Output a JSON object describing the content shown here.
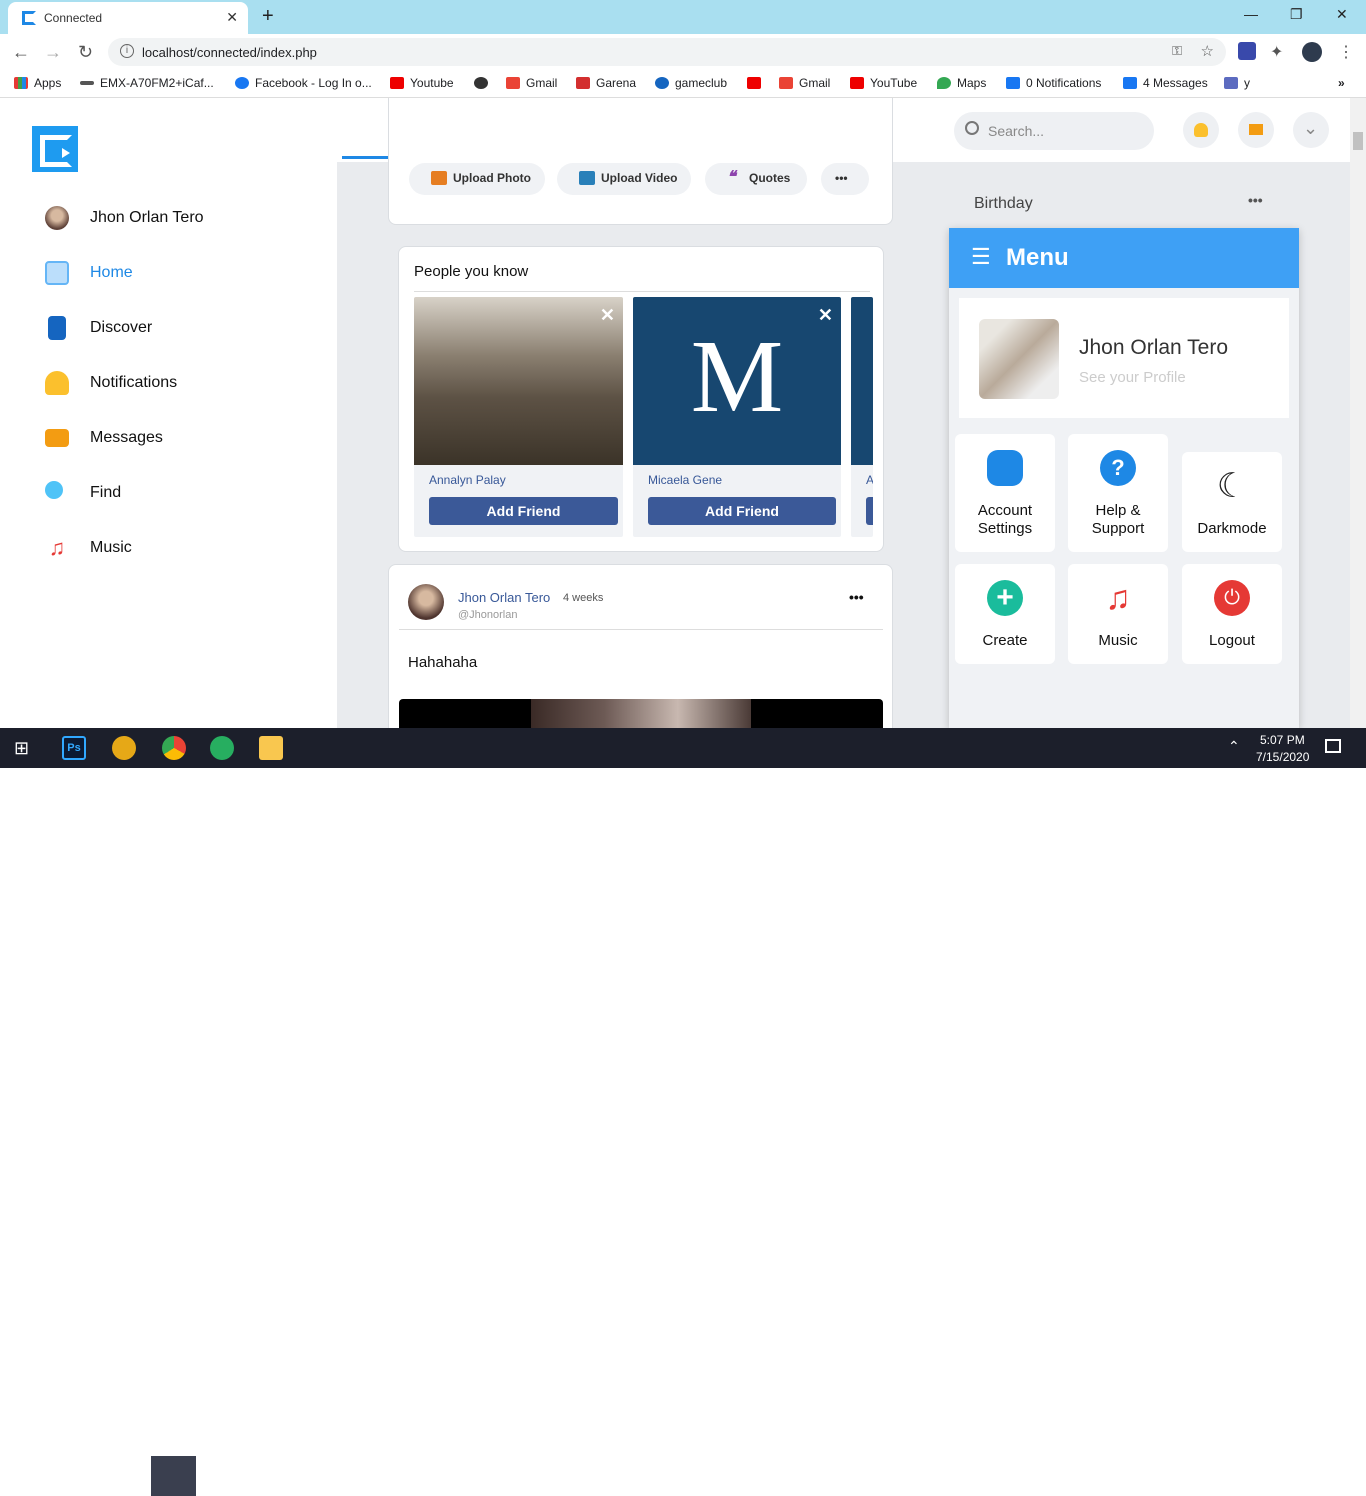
{
  "browser": {
    "tab_title": "Connected",
    "url": "localhost/connected/index.php",
    "bookmarks": [
      "Apps",
      "EMX-A70FM2+iCaf...",
      "Facebook - Log In o...",
      "Youtube",
      "Gmail",
      "Garena",
      "gameclub",
      "Gmail",
      "YouTube",
      "Maps",
      "0 Notifications",
      "4 Messages",
      "y"
    ],
    "close_tab_glyph": "✕",
    "new_tab_glyph": "+"
  },
  "sidebar": {
    "profile_name": "Jhon Orlan Tero",
    "items": [
      {
        "label": "Home",
        "icon": "home-icon",
        "color": "#1e88e5"
      },
      {
        "label": "Discover",
        "icon": "book-icon",
        "color": "#1565c0"
      },
      {
        "label": "Notifications",
        "icon": "bell-icon",
        "color": "#fbc02d"
      },
      {
        "label": "Messages",
        "icon": "envelope-icon",
        "color": "#f39c12"
      },
      {
        "label": "Find",
        "icon": "magnifier-icon",
        "color": "#29b6f6"
      },
      {
        "label": "Music",
        "icon": "music-note-icon",
        "color": "#e53935"
      }
    ]
  },
  "header": {
    "search_placeholder": "Search..."
  },
  "composer": {
    "upload_photo": "Upload Photo",
    "upload_video": "Upload Video",
    "quotes": "Quotes",
    "more": "•••"
  },
  "people_you_know": {
    "title": "People you know",
    "people": [
      {
        "name": "Annalyn Palay",
        "button": "Add Friend"
      },
      {
        "name": "Micaela Gene",
        "button": "Add Friend",
        "avatar_letter": "M"
      },
      {
        "name": "A"
      }
    ],
    "close_glyph": "✕"
  },
  "post": {
    "author": "Jhon Orlan Tero",
    "time": "4 weeks",
    "handle": "@Jhonorlan",
    "text": "Hahahaha",
    "more": "•••"
  },
  "birthday": {
    "label": "Birthday",
    "more": "•••"
  },
  "menu": {
    "title": "Menu",
    "profile_name": "Jhon Orlan Tero",
    "profile_sub": "See your Profile",
    "tiles": [
      {
        "label_line1": "Account",
        "label_line2": "Settings",
        "icon": "gear-icon",
        "color": "#1e88e5"
      },
      {
        "label_line1": "Help &",
        "label_line2": "Support",
        "icon": "question-icon",
        "color": "#1e88e5"
      },
      {
        "label_line1": "Darkmode",
        "label_line2": "",
        "icon": "moon-icon",
        "color": "#333333"
      },
      {
        "label_line1": "Create",
        "label_line2": "",
        "icon": "plus-icon",
        "color": "#1abc9c"
      },
      {
        "label_line1": "Music",
        "label_line2": "",
        "icon": "music-note-icon",
        "color": "#e53935"
      },
      {
        "label_line1": "Logout",
        "label_line2": "",
        "icon": "power-icon",
        "color": "#e53935"
      }
    ]
  },
  "taskbar": {
    "time": "5:07 PM",
    "date": "7/15/2020"
  }
}
